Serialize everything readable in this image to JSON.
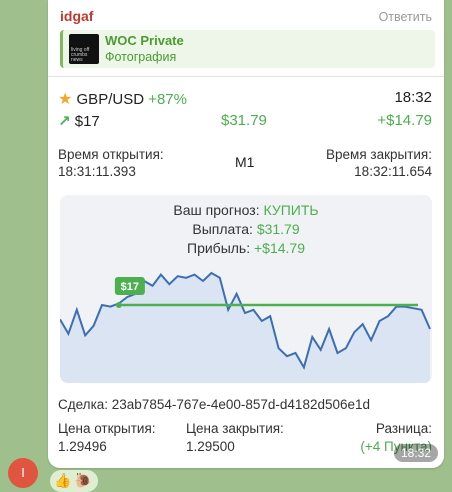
{
  "message": {
    "sender": "idgaf",
    "reply_label": "Ответить",
    "forward": {
      "name": "WOC Private",
      "subtitle": "Фотография",
      "thumb_text": "living off crumbs news"
    },
    "time": "18:32"
  },
  "trade": {
    "pair": "GBP/USD",
    "percent": "+87%",
    "clock": "18:32",
    "stake": "$17",
    "payout_value": "$31.79",
    "profit_value": "+$14.79",
    "open_time_label": "Время открытия:",
    "open_time": "18:31:11.393",
    "timeframe": "M1",
    "close_time_label": "Время закрытия:",
    "close_time": "18:32:11.654",
    "forecast_label": "Ваш прогноз:",
    "forecast_value": "КУПИТЬ",
    "payout_label": "Выплата:",
    "profit_label": "Прибыль:",
    "deal_id": "Сделка: 23ab7854-767e-4e00-857d-d4182d506e1d",
    "open_price_label": "Цена открытия:",
    "open_price": "1.29496",
    "close_price_label": "Цена закрытия:",
    "close_price": "1.29500",
    "diff_label": "Разница:",
    "diff_value": "(+4 Пункта)",
    "chart_badge": "$17"
  },
  "chart_data": {
    "type": "line",
    "values": [
      36,
      27,
      42,
      26,
      32,
      45,
      44,
      46,
      50,
      52,
      60,
      57,
      64,
      58,
      63,
      62,
      64,
      60,
      65,
      62,
      42,
      52,
      40,
      42,
      35,
      38,
      18,
      13,
      15,
      6,
      25,
      17,
      30,
      15,
      18,
      28,
      33,
      23,
      35,
      38,
      44,
      44,
      43,
      42,
      30
    ],
    "entry_level": 45,
    "ylim": [
      0,
      70
    ],
    "colors": {
      "line": "#3b6fb5",
      "fill": "#dbe4f2",
      "entry": "#4caf50"
    }
  },
  "reactions": [
    "👍",
    "🐌"
  ],
  "avatar_letter": "I"
}
